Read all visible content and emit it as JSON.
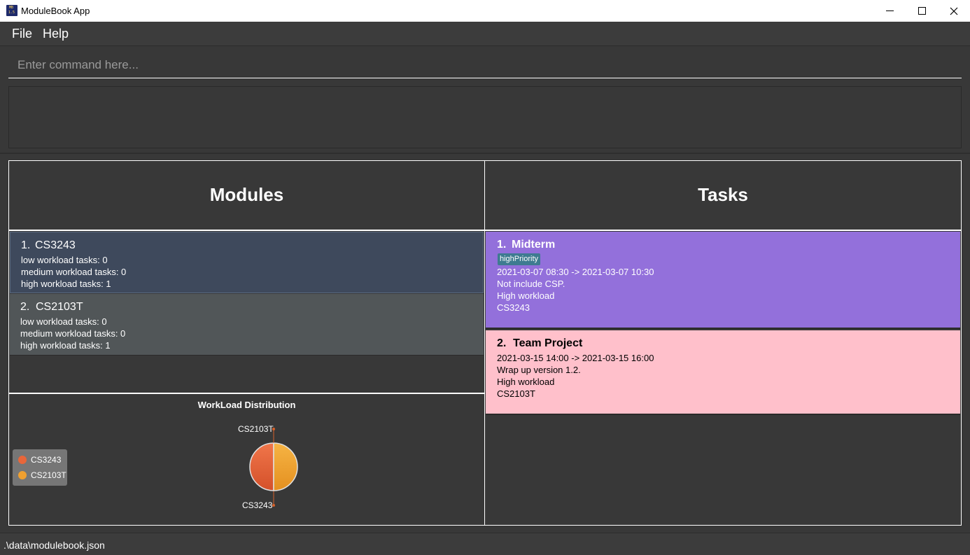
{
  "window": {
    "title": "ModuleBook App"
  },
  "menu": {
    "file": "File",
    "help": "Help"
  },
  "command": {
    "placeholder": "Enter command here..."
  },
  "modules": {
    "header": "Modules",
    "items": [
      {
        "index": "1.",
        "code": "CS3243",
        "low": "low workload tasks: 0",
        "medium": "medium workload tasks: 0",
        "high": "high workload tasks: 1"
      },
      {
        "index": "2.",
        "code": "CS2103T",
        "low": "low workload tasks: 0",
        "medium": "medium workload tasks: 0",
        "high": "high workload tasks: 1"
      }
    ]
  },
  "tasks": {
    "header": "Tasks",
    "items": [
      {
        "index": "1.",
        "name": "Midterm",
        "tag": "highPriority",
        "time": "2021-03-07 08:30 -> 2021-03-07 10:30",
        "description": "Not include CSP.",
        "workload": "High workload",
        "module": "CS3243",
        "color": "#9370db"
      },
      {
        "index": "2.",
        "name": "Team Project",
        "time": "2021-03-15 14:00 -> 2021-03-15 16:00",
        "description": "Wrap up version 1.2.",
        "workload": "High workload",
        "module": "CS2103T",
        "color": "#ffc0cb"
      }
    ]
  },
  "chart_data": {
    "type": "pie",
    "title": "WorkLoad Distribution",
    "categories": [
      "CS3243",
      "CS2103T"
    ],
    "values": [
      1,
      1
    ],
    "colors": [
      "#e8663a",
      "#f0a030"
    ],
    "legend": "left"
  },
  "status": {
    "path": ".\\data\\modulebook.json"
  }
}
